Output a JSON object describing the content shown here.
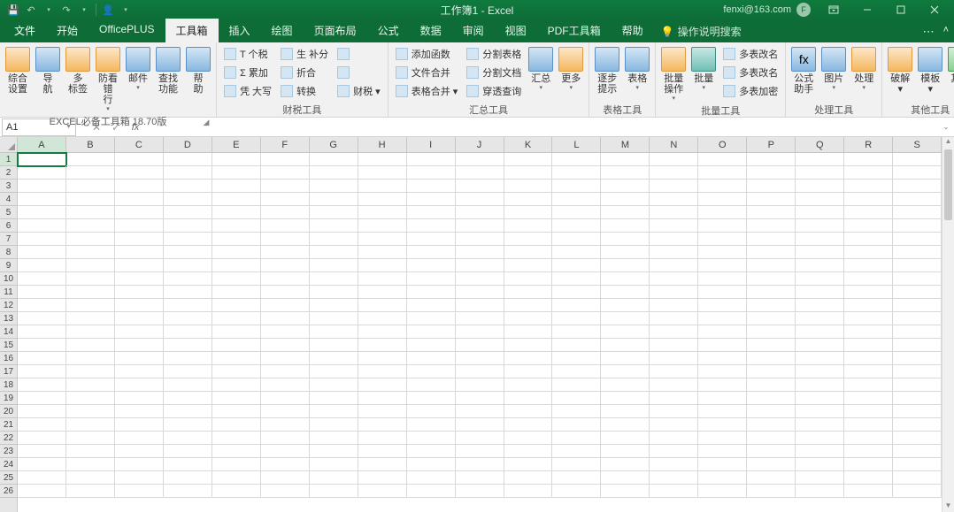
{
  "titlebar": {
    "title": "工作簿1 - Excel",
    "user_email": "fenxi@163.com",
    "avatar_initial": "F"
  },
  "tabs": {
    "items": [
      {
        "label": "文件",
        "kind": "file"
      },
      {
        "label": "开始"
      },
      {
        "label": "OfficePLUS"
      },
      {
        "label": "工具箱",
        "active": true
      },
      {
        "label": "插入"
      },
      {
        "label": "绘图"
      },
      {
        "label": "页面布局"
      },
      {
        "label": "公式"
      },
      {
        "label": "数据"
      },
      {
        "label": "审阅"
      },
      {
        "label": "视图"
      },
      {
        "label": "PDF工具箱"
      },
      {
        "label": "帮助"
      }
    ],
    "tell_me": "操作说明搜索"
  },
  "ribbon": {
    "groups": [
      {
        "label": "EXCEL必备工具箱 18.70版",
        "launcher": true,
        "large": [
          {
            "label": "综合\n设置",
            "style": "orange"
          },
          {
            "label": "导\n航",
            "style": "blue"
          },
          {
            "label": "多\n标签",
            "style": "orange"
          },
          {
            "label": "防看错\n行",
            "style": "orange",
            "arrow": true
          },
          {
            "label": "邮件",
            "style": "blue",
            "arrow": true
          },
          {
            "label": "查找\n功能",
            "style": "blue"
          },
          {
            "label": "帮\n助",
            "style": "blue"
          }
        ]
      },
      {
        "label": "财税工具",
        "small": [
          [
            {
              "label": "T 个税"
            },
            {
              "label": "Σ 累加"
            },
            {
              "label": "凭 大写"
            }
          ],
          [
            {
              "label": "生 补分"
            },
            {
              "label": "折合"
            },
            {
              "label": "转换"
            }
          ],
          [
            {
              "label": "",
              "icn_only": true
            },
            {
              "label": "",
              "icn_only": true
            },
            {
              "label": "财税 ▾",
              "icn_only": false
            }
          ]
        ]
      },
      {
        "label": "汇总工具",
        "small_pre": [
          [
            {
              "label": "添加函数"
            },
            {
              "label": "文件合并"
            },
            {
              "label": "表格合并 ▾"
            }
          ],
          [
            {
              "label": "分割表格"
            },
            {
              "label": "分割文档"
            },
            {
              "label": "穿透查询"
            }
          ]
        ],
        "large": [
          {
            "label": "汇总",
            "style": "blue",
            "arrow": true
          },
          {
            "label": "更多",
            "style": "orange",
            "arrow": true
          }
        ]
      },
      {
        "label": "表格工具",
        "large": [
          {
            "label": "逐步\n提示",
            "style": "blue"
          },
          {
            "label": "表格",
            "style": "blue",
            "arrow": true
          }
        ]
      },
      {
        "label": "批量工具",
        "large": [
          {
            "label": "批量\n操作",
            "style": "orange",
            "arrow": true
          },
          {
            "label": "批量",
            "style": "teal",
            "arrow": true
          }
        ],
        "small": [
          [
            {
              "label": "多表改名"
            },
            {
              "label": "多表改名"
            },
            {
              "label": "多表加密"
            }
          ]
        ]
      },
      {
        "label": "处理工具",
        "large": [
          {
            "label": "公式\n助手",
            "style": "blue",
            "glyph": "fx"
          },
          {
            "label": "图片",
            "style": "blue",
            "arrow": true
          },
          {
            "label": "处理",
            "style": "orange",
            "arrow": true
          }
        ]
      },
      {
        "label": "其他工具",
        "large": [
          {
            "label": "破解 ▾",
            "style": "orange"
          },
          {
            "label": "模板 ▾",
            "style": "blue"
          },
          {
            "label": "其他 ▾",
            "style": "green"
          }
        ]
      }
    ]
  },
  "namebox": {
    "value": "A1"
  },
  "sheet": {
    "columns": [
      "A",
      "B",
      "C",
      "D",
      "E",
      "F",
      "G",
      "H",
      "I",
      "J",
      "K",
      "L",
      "M",
      "N",
      "O",
      "P",
      "Q",
      "R",
      "S"
    ],
    "rows": 26,
    "active_cell": {
      "row": 1,
      "col": "A"
    }
  }
}
